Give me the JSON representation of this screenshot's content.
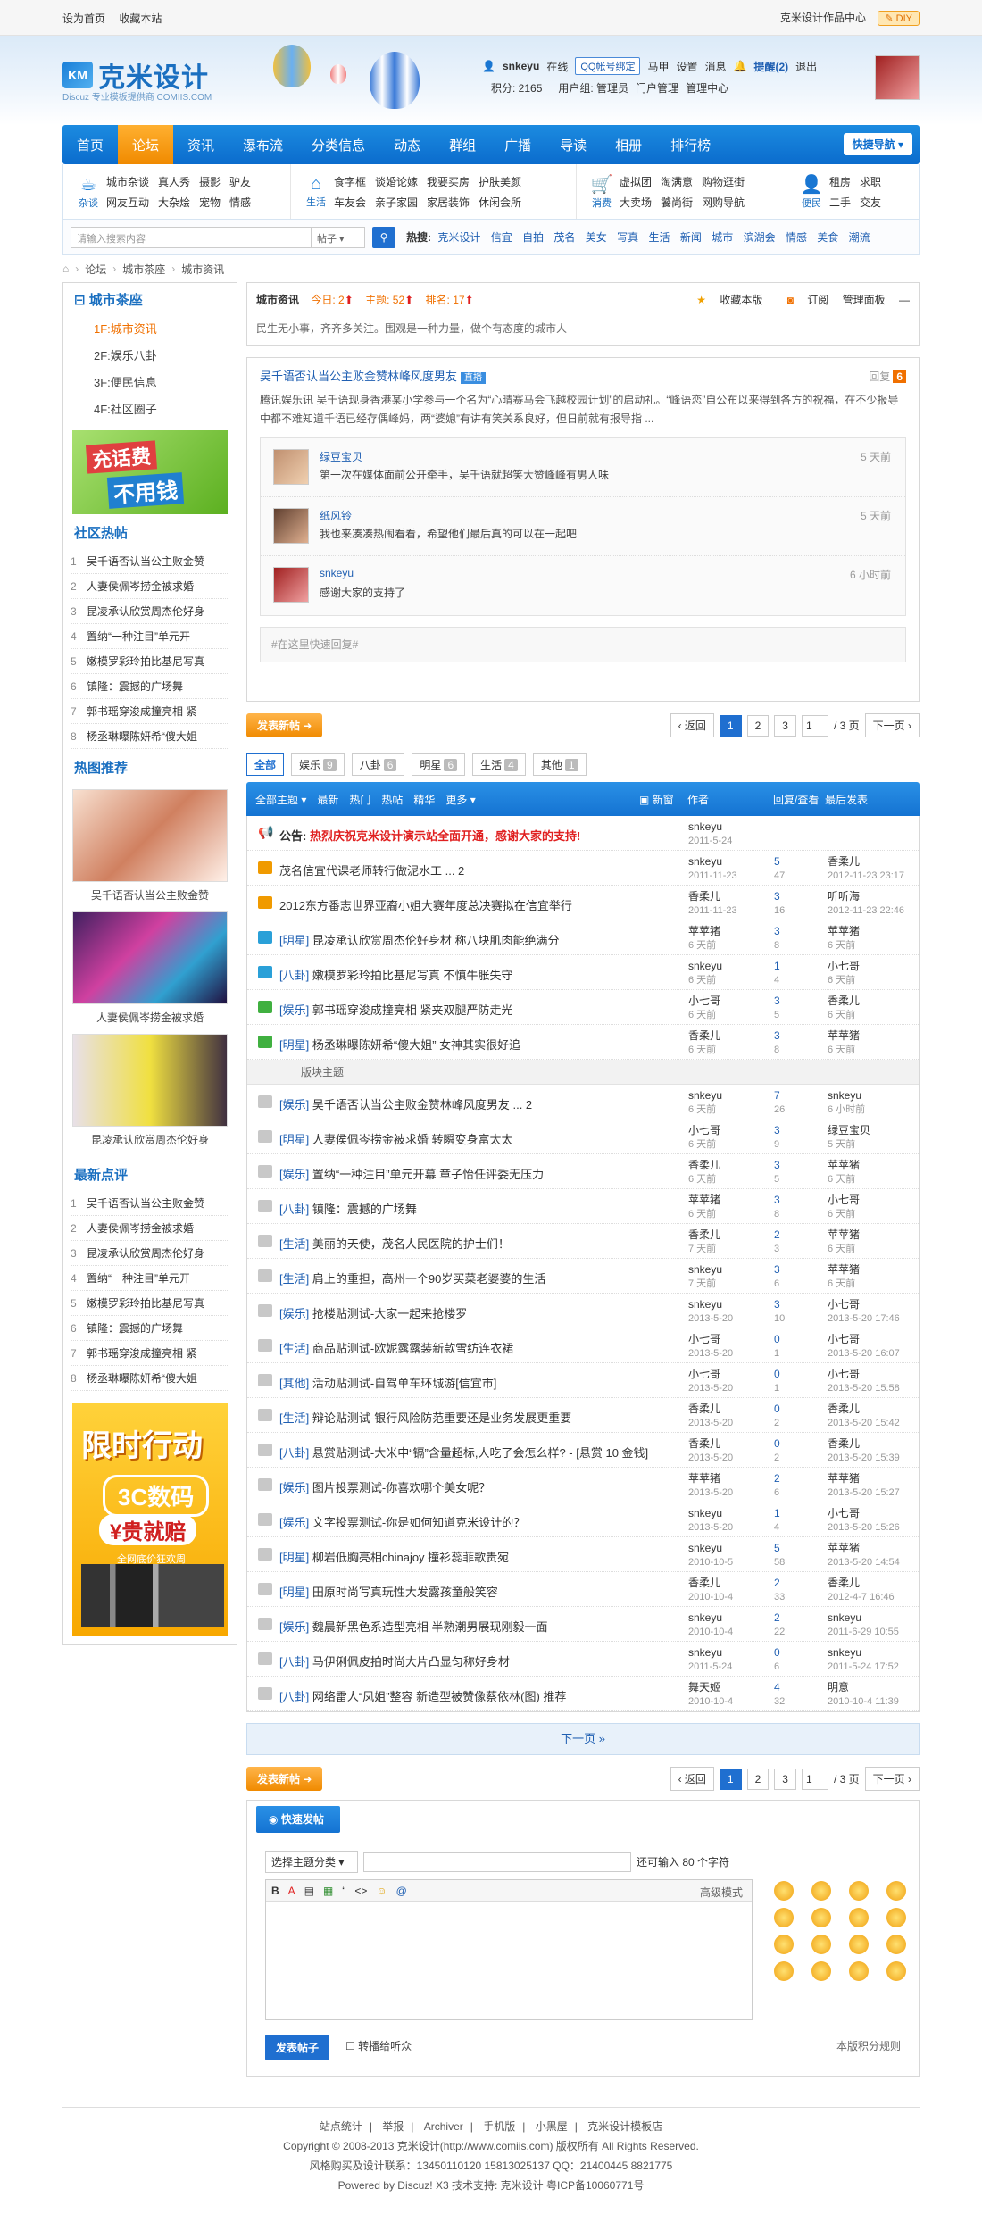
{
  "topbar": {
    "set_home": "设为首页",
    "bookmark": "收藏本站",
    "works_center": "克米设计作品中心",
    "diy": "DIY"
  },
  "logo": {
    "mark": "KM",
    "name": "克米设计",
    "sub": "Discuz 专业模板提供商  COMIIS.COM"
  },
  "user": {
    "name": "snkeyu",
    "online": "在线",
    "qq_bind": "QQ帐号绑定",
    "horse": "马甲",
    "settings": "设置",
    "messages": "消息",
    "reminders": "提醒(2)",
    "logout": "退出",
    "points": "积分: 2165",
    "usergroup": "用户组: 管理员",
    "portal_admin": "门户管理",
    "admin_center": "管理中心"
  },
  "nav": {
    "items": [
      "首页",
      "论坛",
      "资讯",
      "瀑布流",
      "分类信息",
      "动态",
      "群组",
      "广播",
      "导读",
      "相册",
      "排行榜"
    ],
    "quick": "快捷导航"
  },
  "subnav": {
    "groups": [
      {
        "label": "杂谈",
        "links": [
          "城市杂谈",
          "真人秀",
          "摄影",
          "驴友",
          "网友互动",
          "大杂烩",
          "宠物",
          "情感"
        ]
      },
      {
        "label": "生活",
        "links": [
          "食字框",
          "谈婚论嫁",
          "我要买房",
          "护肤美颜",
          "车友会",
          "亲子家园",
          "家居装饰",
          "休闲会所"
        ]
      },
      {
        "label": "消费",
        "links": [
          "虚拟团",
          "淘满意",
          "购物逛街",
          "大卖场",
          "饕尚街",
          "网购导航"
        ]
      },
      {
        "label": "便民",
        "links": [
          "租房",
          "求职",
          "二手",
          "交友"
        ]
      }
    ]
  },
  "search": {
    "placeholder": "请输入搜索内容",
    "scope": "帖子",
    "hot_label": "热搜:",
    "hot": [
      "克米设计",
      "信宜",
      "自拍",
      "茂名",
      "美女",
      "写真",
      "生活",
      "新闻",
      "城市",
      "滨湖会",
      "情感",
      "美食",
      "潮流"
    ]
  },
  "crumb": [
    "论坛",
    "城市茶座",
    "城市资讯"
  ],
  "sidebar": {
    "title": "城市茶座",
    "forums": [
      "1F:城市资讯",
      "2F:娱乐八卦",
      "3F:便民信息",
      "4F:社区圈子"
    ],
    "ad1": {
      "line1": "充话费",
      "line2": "不用钱"
    },
    "hot_title": "社区热帖",
    "hot": [
      "吴千语否认当公主败金赞",
      "人妻侯佩岑捞金被求婚",
      "昆凌承认欣赏周杰伦好身",
      "置纳“一种注目”单元开",
      "嫩模罗彩玲拍比基尼写真",
      "镇隆：震撼的广场舞",
      "郭书瑶穿浚成撞亮相 紧",
      "杨丞琳曝陈妍希“傻大姐"
    ],
    "rec_title": "热图推荐",
    "rec": [
      "吴千语否认当公主败金赞",
      "人妻侯佩岑捞金被求婚",
      "昆凌承认欣赏周杰伦好身"
    ],
    "new_title": "最新点评",
    "new": [
      "吴千语否认当公主败金赞",
      "人妻侯佩岑捞金被求婚",
      "昆凌承认欣赏周杰伦好身",
      "置纳“一种注目”单元开",
      "嫩模罗彩玲拍比基尼写真",
      "镇隆：震撼的广场舞",
      "郭书瑶穿浚成撞亮相 紧",
      "杨丞琳曝陈妍希“傻大姐"
    ],
    "ad2": {
      "a1": "限时行动",
      "a2": "3C数码",
      "a3": "¥贵就赔",
      "a4": "全网底价狂欢周"
    }
  },
  "forum": {
    "name": "城市资讯",
    "today": "今日: 2",
    "topics": "主题: 52",
    "rank": "排名: 17",
    "fav": "收藏本版",
    "rss": "订阅",
    "panel": "管理面板",
    "desc": "民生无小事，齐齐多关注。围观是一种力量，做个有态度的城市人"
  },
  "sticky": {
    "title": "吴千语否认当公主败金赞林峰风度男友",
    "live": "直播",
    "reply_label": "回复",
    "reply_count": "6",
    "body": "腾讯娱乐讯 吴千语现身香港某小学参与一个名为“心晴赛马会飞越校园计划”的启动礼。“峰语恋”自公布以来得到各方的祝福，在不少报导中都不难知道千语已经存偶峰妈，两“婆媳”有讲有笑关系良好，但日前就有报导指 ...",
    "comments": [
      {
        "user": "绿豆宝贝",
        "text": "第一次在媒体面前公开牵手，吴千语就超笑大赞峰峰有男人味",
        "time": "5 天前"
      },
      {
        "user": "纸风铃",
        "text": "我也来凑凑热闹看看，希望他们最后真的可以在一起吧",
        "time": "5 天前"
      },
      {
        "user": "snkeyu",
        "text": "感谢大家的支持了",
        "time": "6 小时前"
      }
    ],
    "quick": "#在这里快速回复#"
  },
  "pager": {
    "post": "发表新帖",
    "prev": "‹ 返回",
    "pages": [
      "1",
      "2",
      "3"
    ],
    "input": "1",
    "total": "/ 3 页",
    "next": "下一页 ›"
  },
  "types": [
    {
      "label": "全部",
      "count": ""
    },
    {
      "label": "娱乐",
      "count": "9"
    },
    {
      "label": "八卦",
      "count": "6"
    },
    {
      "label": "明星",
      "count": "6"
    },
    {
      "label": "生活",
      "count": "4"
    },
    {
      "label": "其他",
      "count": "1"
    }
  ],
  "thead": {
    "filters": [
      "全部主题 ▾",
      "最新",
      "热门",
      "热帖",
      "精华",
      "更多 ▾"
    ],
    "new": "新窗",
    "author": "作者",
    "replies": "回复/查看",
    "last": "最后发表"
  },
  "announcement": {
    "label": "公告:",
    "text": "热烈庆祝克米设计演示站全面开通，感谢大家的支持!",
    "author": "snkeyu",
    "date": "2011-5-24"
  },
  "top_threads": [
    {
      "title": "茂名信宜代课老师转行做泥水工 ... 2",
      "cat": "",
      "author": "snkeyu",
      "date": "2011-11-23",
      "r": "5",
      "v": "47",
      "last": "香柔儿",
      "last_date": "2012-11-23 23:17",
      "color": "#f09a00"
    },
    {
      "title": "2012东方番志世界亚裔小姐大赛年度总决赛拟在信宜举行",
      "cat": "",
      "author": "香柔儿",
      "date": "2011-11-23",
      "r": "3",
      "v": "16",
      "last": "听听海",
      "last_date": "2012-11-23 22:46",
      "color": "#f09a00"
    },
    {
      "title": "昆凌承认欣赏周杰伦好身材 称八块肌肉能绝满分",
      "cat": "[明星]",
      "author": "苹苹猪",
      "date": "6 天前",
      "r": "3",
      "v": "8",
      "last": "苹苹猪",
      "last_date": "6 天前",
      "color": "#2aa0d8"
    },
    {
      "title": "嫩模罗彩玲拍比基尼写真 不慎牛胀失守",
      "cat": "[八卦]",
      "author": "snkeyu",
      "date": "6 天前",
      "r": "1",
      "v": "4",
      "last": "小七哥",
      "last_date": "6 天前",
      "color": "#2aa0d8"
    },
    {
      "title": "郭书瑶穿浚成撞亮相 紧夹双腿严防走光",
      "cat": "[娱乐]",
      "author": "小七哥",
      "date": "6 天前",
      "r": "3",
      "v": "5",
      "last": "香柔儿",
      "last_date": "6 天前",
      "color": "#40b040"
    },
    {
      "title": "杨丞琳曝陈妍希“傻大姐” 女神其实很好追",
      "cat": "[明星]",
      "author": "香柔儿",
      "date": "6 天前",
      "r": "3",
      "v": "8",
      "last": "苹苹猪",
      "last_date": "6 天前",
      "color": "#40b040"
    }
  ],
  "separator": "版块主题",
  "threads": [
    {
      "title": "吴千语否认当公主败金赞林峰风度男友 ... 2",
      "cat": "[娱乐]",
      "author": "snkeyu",
      "date": "6 天前",
      "r": "7",
      "v": "26",
      "last": "snkeyu",
      "last_date": "6 小时前"
    },
    {
      "title": "人妻侯佩岑捞金被求婚 转瞬变身富太太",
      "cat": "[明星]",
      "author": "小七哥",
      "date": "6 天前",
      "r": "3",
      "v": "9",
      "last": "绿豆宝贝",
      "last_date": "5 天前"
    },
    {
      "title": "置纳“一种注目”单元开幕 章子怡任评委无压力",
      "cat": "[娱乐]",
      "author": "香柔儿",
      "date": "6 天前",
      "r": "3",
      "v": "5",
      "last": "苹苹猪",
      "last_date": "6 天前"
    },
    {
      "title": "镇隆：震撼的广场舞",
      "cat": "[八卦]",
      "author": "苹苹猪",
      "date": "6 天前",
      "r": "3",
      "v": "8",
      "last": "小七哥",
      "last_date": "6 天前"
    },
    {
      "title": "美丽的天使，茂名人民医院的护士们！",
      "cat": "[生活]",
      "author": "香柔儿",
      "date": "7 天前",
      "r": "2",
      "v": "3",
      "last": "苹苹猪",
      "last_date": "6 天前"
    },
    {
      "title": "肩上的重担，高州一个90岁买菜老婆婆的生活",
      "cat": "[生活]",
      "author": "snkeyu",
      "date": "7 天前",
      "r": "3",
      "v": "6",
      "last": "苹苹猪",
      "last_date": "6 天前"
    },
    {
      "title": "抢楼贴测试-大家一起来抢楼罗",
      "cat": "[娱乐]",
      "author": "snkeyu",
      "date": "2013-5-20",
      "r": "3",
      "v": "10",
      "last": "小七哥",
      "last_date": "2013-5-20 17:46"
    },
    {
      "title": "商品贴测试-欧妮露露装新款雪纺连衣裙",
      "cat": "[生活]",
      "author": "小七哥",
      "date": "2013-5-20",
      "r": "0",
      "v": "1",
      "last": "小七哥",
      "last_date": "2013-5-20 16:07"
    },
    {
      "title": "活动贴测试-自驾单车环城游[信宜市]",
      "cat": "[其他]",
      "author": "小七哥",
      "date": "2013-5-20",
      "r": "0",
      "v": "1",
      "last": "小七哥",
      "last_date": "2013-5-20 15:58"
    },
    {
      "title": "辩论贴测试-银行风险防范重要还是业务发展更重要",
      "cat": "[生活]",
      "author": "香柔儿",
      "date": "2013-5-20",
      "r": "0",
      "v": "2",
      "last": "香柔儿",
      "last_date": "2013-5-20 15:42"
    },
    {
      "title": "悬赏贴测试-大米中“镉”含量超标,人吃了会怎么样? - [悬赏 10 金钱]",
      "cat": "[八卦]",
      "author": "香柔儿",
      "date": "2013-5-20",
      "r": "0",
      "v": "2",
      "last": "香柔儿",
      "last_date": "2013-5-20 15:39"
    },
    {
      "title": "图片投票测试-你喜欢哪个美女呢？",
      "cat": "[娱乐]",
      "author": "苹苹猪",
      "date": "2013-5-20",
      "r": "2",
      "v": "6",
      "last": "苹苹猪",
      "last_date": "2013-5-20 15:27"
    },
    {
      "title": "文字投票测试-你是如何知道克米设计的？",
      "cat": "[娱乐]",
      "author": "snkeyu",
      "date": "2013-5-20",
      "r": "1",
      "v": "4",
      "last": "小七哥",
      "last_date": "2013-5-20 15:26"
    },
    {
      "title": "柳岩低胸亮相chinajoy 撞衫蕊菲歌贵宛",
      "cat": "[明星]",
      "author": "snkeyu",
      "date": "2010-10-5",
      "r": "5",
      "v": "58",
      "last": "苹苹猪",
      "last_date": "2013-5-20 14:54"
    },
    {
      "title": "田原时尚写真玩性大发露孩童般笑容",
      "cat": "[明星]",
      "author": "香柔儿",
      "date": "2010-10-4",
      "r": "2",
      "v": "33",
      "last": "香柔儿",
      "last_date": "2012-4-7 16:46"
    },
    {
      "title": "魏晨新黑色系造型亮相 半熟潮男展现刚毅一面",
      "cat": "[娱乐]",
      "author": "snkeyu",
      "date": "2010-10-4",
      "r": "2",
      "v": "22",
      "last": "snkeyu",
      "last_date": "2011-6-29 10:55"
    },
    {
      "title": "马伊俐佩皮拍时尚大片凸显匀称好身材",
      "cat": "[八卦]",
      "author": "snkeyu",
      "date": "2011-5-24",
      "r": "0",
      "v": "6",
      "last": "snkeyu",
      "last_date": "2011-5-24 17:52"
    },
    {
      "title": "网络雷人“凤姐”整容 新造型被赞像蔡依林(图) 推荐",
      "cat": "[八卦]",
      "author": "舞天姬",
      "date": "2010-10-4",
      "r": "4",
      "v": "32",
      "last": "明意",
      "last_date": "2010-10-4 11:39"
    }
  ],
  "nextpage": "下一页 »",
  "fastpost": {
    "title": "快速发帖",
    "type_select": "选择主题分类",
    "limit": "还可输入 80 个字符",
    "toolbar": [
      "B",
      "A",
      "▤",
      "▦",
      "“",
      "<>",
      "☺",
      "@"
    ],
    "advanced": "高级模式",
    "submit": "发表帖子",
    "broadcast": "转播给听众",
    "rules": "本版积分规则"
  },
  "footer": {
    "links": [
      "站点统计",
      "举报",
      "Archiver",
      "手机版",
      "小黑屋",
      "克米设计模板店"
    ],
    "copyright": "Copyright © 2008-2013 克米设计(http://www.comiis.com) 版权所有 All Rights Reserved.",
    "contact": "风格购买及设计联系：13450110120 15813025137 QQ：21400445 8821775",
    "powered": "Powered by Discuz! X3  技术支持: 克米设计 粤ICP备10060771号"
  }
}
